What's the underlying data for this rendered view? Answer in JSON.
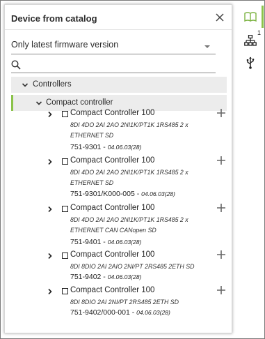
{
  "panel": {
    "title": "Device from catalog",
    "filter": {
      "selected": "Only latest firmware version"
    },
    "search": {
      "placeholder": "",
      "value": ""
    }
  },
  "tree": {
    "groups": [
      {
        "label": "Controllers",
        "expanded": true
      },
      {
        "label": "Compact controller",
        "expanded": true
      }
    ],
    "devices": [
      {
        "name": "Compact Controller 100",
        "desc": "8DI 4DO 2AI 2AO 2NI1K/PT1K 1RS485 2 x ETHERNET SD",
        "order": "751-9301 - ",
        "version": "04.06.03(28)"
      },
      {
        "name": "Compact Controller 100",
        "desc": "8DI 4DO 2AI 2AO 2NI1K/PT1K 1RS485 2 x ETHERNET SD",
        "order": "751-9301/K000-005 - ",
        "version": "04.06.03(28)"
      },
      {
        "name": "Compact Controller 100",
        "desc": "8DI 4DO 2AI 2AO 2NI1K/PT1K 1RS485 2 x ETHERNET CAN CANopen SD",
        "order": "751-9401 - ",
        "version": "04.06.03(28)"
      },
      {
        "name": "Compact Controller 100",
        "desc": "8DI 8DIO 2AI 2AIO 2NI/PT 2RS485 2ETH SD",
        "order": "751-9402 - ",
        "version": "04.06.03(28)"
      },
      {
        "name": "Compact Controller 100",
        "desc": "8DI 8DIO 2AI 2NI/PT 2RS485 2ETH SD",
        "order": "751-9402/000-001 - ",
        "version": "04.06.03(28)"
      }
    ]
  },
  "sidebar": {
    "tabs": [
      {
        "icon": "book-open-icon",
        "active": true
      },
      {
        "icon": "network-tree-icon",
        "badge": "1"
      },
      {
        "icon": "usb-icon"
      }
    ]
  },
  "colors": {
    "accent": "#8bc34a",
    "row_bg": "#ececec",
    "header_text": "#2b2b2b"
  }
}
